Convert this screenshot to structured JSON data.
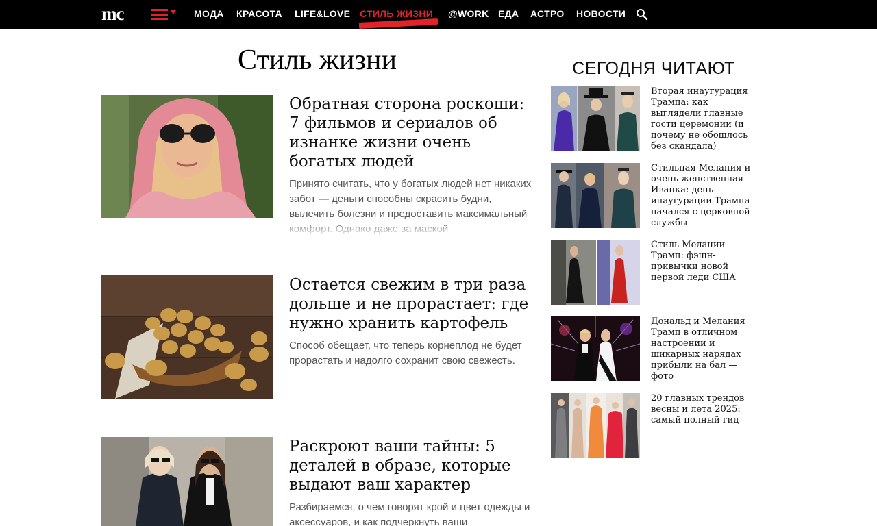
{
  "header": {
    "logo": "mc",
    "nav": [
      {
        "label": "МОДА"
      },
      {
        "label": "КРАСОТА"
      },
      {
        "label": "LIFE&LOVE"
      },
      {
        "label": "СТИЛЬ ЖИЗНИ",
        "active": true
      },
      {
        "label": "@WORK"
      },
      {
        "label": "ЕДА"
      },
      {
        "label": "АСТРО"
      },
      {
        "label": "НОВОСТИ"
      }
    ],
    "accent": "#e2232a"
  },
  "main": {
    "title": "Стиль жизни",
    "articles": [
      {
        "headline": "Обратная сторона роскоши: 7 фильмов и сериалов об изнанке жизни очень богатых людей",
        "lede": "Принято считать, что у богатых людей нет никаких забот — деньги способны скрасить будни, вылечить болезни и предоставить максимальный комфорт. Однако даже за маской"
      },
      {
        "headline": "Остается свежим в три раза дольше и не прорастает: где нужно хранить картофель",
        "lede": "Способ обещает, что теперь корнеплод не будет прорастать и надолго сохранит свою свежесть."
      },
      {
        "headline": "Раскроют ваши тайны: 5 деталей в образе, которые выдают ваш характер",
        "lede": "Разбираемся, о чем говорят крой и цвет одежды и аксессуаров, и как подчеркнуть ваши"
      }
    ]
  },
  "sidebar": {
    "title": "СЕГОДНЯ ЧИТАЮТ",
    "items": [
      {
        "text": "Вторая инаугурация Трампа: как выглядели главные гости церемонии (и почему не обошлось без скандала)"
      },
      {
        "text": "Стильная Мелания и очень женственная Иванка: день инаугурации Трампа начался с церковной службы"
      },
      {
        "text": "Стиль Мелании Трамп: фэшн-привычки новой первой леди США"
      },
      {
        "text": "Дональд и Мелания Трамп в отличном настроении и шикарных нарядах прибыли на бал — фото"
      },
      {
        "text": "20 главных трендов весны и лета 2025: самый полный гид"
      }
    ]
  }
}
